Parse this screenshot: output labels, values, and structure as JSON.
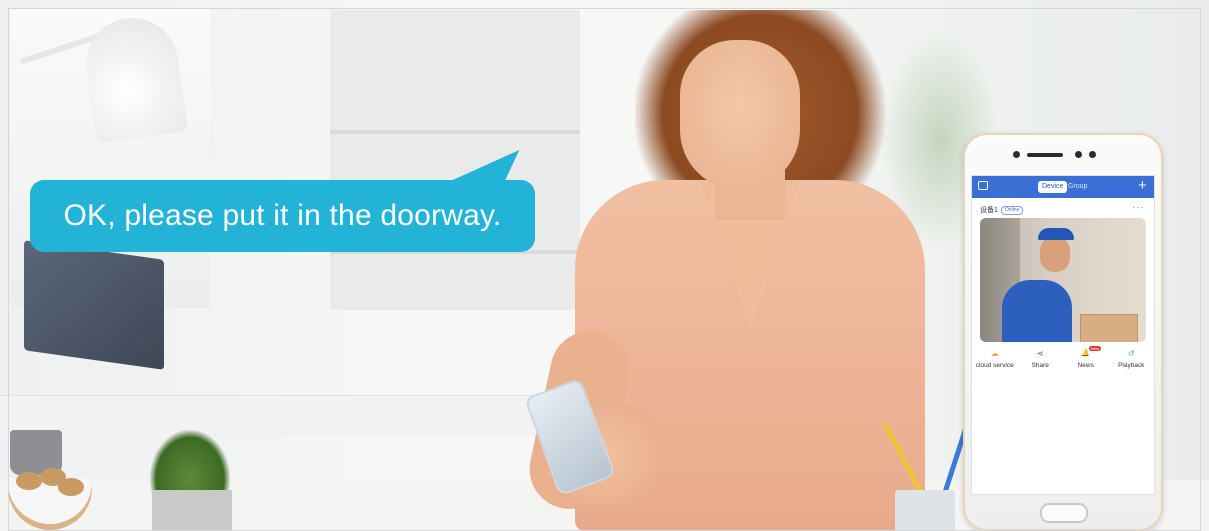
{
  "speech_bubble": {
    "text": "OK, please put it in the doorway."
  },
  "app": {
    "header": {
      "tabs": [
        "Device",
        "Group"
      ],
      "add_symbol": "+"
    },
    "device": {
      "name": "设备1",
      "status": "Online",
      "more_symbol": "···"
    },
    "actions": [
      {
        "label": "cloud service",
        "icon": "cloud-icon",
        "glyph": "☁",
        "color": "#f0a833"
      },
      {
        "label": "Share",
        "icon": "share-icon",
        "glyph": "⋖",
        "color": "#666666"
      },
      {
        "label": "News",
        "icon": "bell-icon",
        "glyph": "🔔",
        "color": "#3b6fd6",
        "badge": "New"
      },
      {
        "label": "Playback",
        "icon": "playback-icon",
        "glyph": "↺",
        "color": "#3bb0a6"
      }
    ]
  },
  "colors": {
    "accent": "#3b6fd6",
    "bubble": "#22b3d6"
  }
}
